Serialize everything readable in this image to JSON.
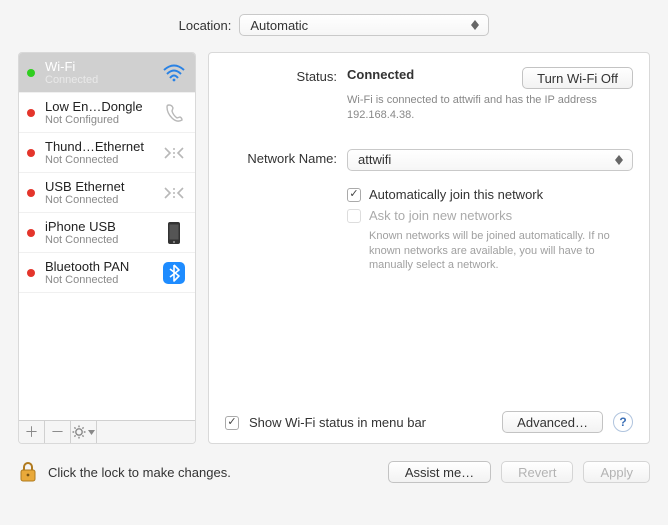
{
  "location": {
    "label": "Location:",
    "value": "Automatic"
  },
  "interfaces": [
    {
      "name": "Wi-Fi",
      "status": "Connected",
      "dot": "green",
      "icon": "wifi",
      "selected": true
    },
    {
      "name": "Low En…Dongle",
      "status": "Not Configured",
      "dot": "red",
      "icon": "phone",
      "selected": false
    },
    {
      "name": "Thund…Ethernet",
      "status": "Not Connected",
      "dot": "red",
      "icon": "ethernet",
      "selected": false
    },
    {
      "name": "USB Ethernet",
      "status": "Not Connected",
      "dot": "red",
      "icon": "ethernet",
      "selected": false
    },
    {
      "name": "iPhone USB",
      "status": "Not Connected",
      "dot": "red",
      "icon": "iphone",
      "selected": false
    },
    {
      "name": "Bluetooth PAN",
      "status": "Not Connected",
      "dot": "red",
      "icon": "bluetooth",
      "selected": false
    }
  ],
  "detail": {
    "status_label": "Status:",
    "status_value": "Connected",
    "status_sub": "Wi-Fi is connected to attwifi and has the IP address 192.168.4.38.",
    "toggle_button": "Turn Wi-Fi Off",
    "network_label": "Network Name:",
    "network_value": "attwifi",
    "auto_join": "Automatically join this network",
    "ask_join": "Ask to join new networks",
    "ask_help": "Known networks will be joined automatically. If no known networks are available, you will have to manually select a network.",
    "show_status": "Show Wi-Fi status in menu bar",
    "advanced": "Advanced…"
  },
  "footer": {
    "lock_text": "Click the lock to make changes.",
    "assist": "Assist me…",
    "revert": "Revert",
    "apply": "Apply"
  }
}
